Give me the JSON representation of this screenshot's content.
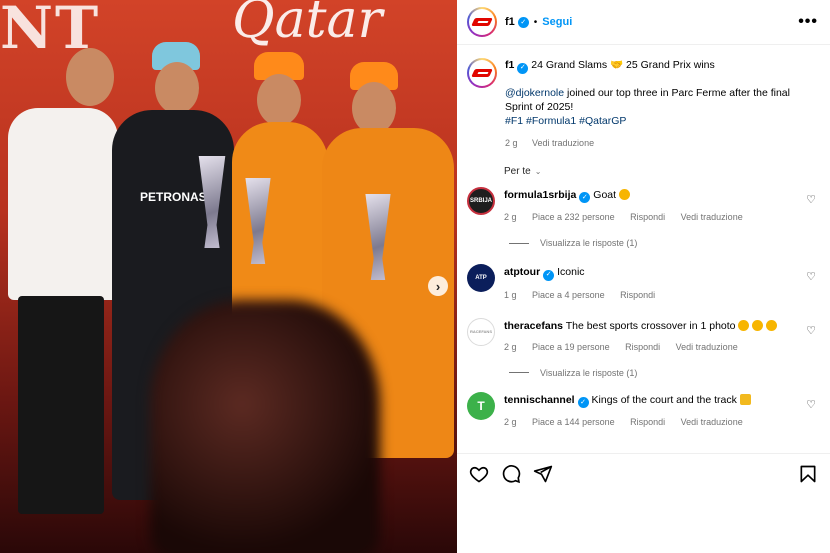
{
  "post": {
    "username": "f1",
    "follow_label": "Segui",
    "more_label": "•••",
    "dot": "•",
    "caption_line1": "24 Grand Slams 🤝 25 Grand Prix wins",
    "caption_mention": "@djokernole",
    "caption_line2": " joined our top three in Parc Ferme after the final Sprint of 2025!",
    "hashtags": "#F1 #Formula1 #QatarGP",
    "time": "2 g",
    "translate_label": "Vedi traduzione",
    "sort_label": "Per te",
    "sort_chevron": "⌄"
  },
  "photo": {
    "bg_text_left": "NT",
    "bg_text_script": "Qatar",
    "team_text": "PETRONAS",
    "next_arrow": "›"
  },
  "comments": [
    {
      "username": "formula1srbija",
      "text": "Goat",
      "time": "2 g",
      "likes": "Piace a 232 persone",
      "reply": "Rispondi",
      "translate": "Vedi traduzione",
      "view_replies": "Visualizza le risposte (1)",
      "avatar_text": "SRBIJA"
    },
    {
      "username": "atptour",
      "text": "Iconic",
      "time": "1 g",
      "likes": "Piace a 4 persone",
      "reply": "Rispondi",
      "avatar_text": "ATP"
    },
    {
      "username": "theracefans",
      "text": "The best sports crossover in 1 photo",
      "time": "2 g",
      "likes": "Piace a 19 persone",
      "reply": "Rispondi",
      "translate": "Vedi traduzione",
      "view_replies": "Visualizza le risposte (1)",
      "avatar_text": "RACEFANS"
    },
    {
      "username": "tennischannel",
      "text": "Kings of the court and the track",
      "time": "2 g",
      "likes": "Piace a 144 persone",
      "reply": "Rispondi",
      "translate": "Vedi traduzione",
      "avatar_text": "T"
    }
  ],
  "colors": {
    "accent": "#0095f6",
    "f1_red": "#e10600",
    "link": "#00376b",
    "muted": "#737373"
  },
  "icons": [
    "heart-icon",
    "comment-icon",
    "share-icon",
    "bookmark-icon",
    "verified-icon",
    "more-icon"
  ]
}
